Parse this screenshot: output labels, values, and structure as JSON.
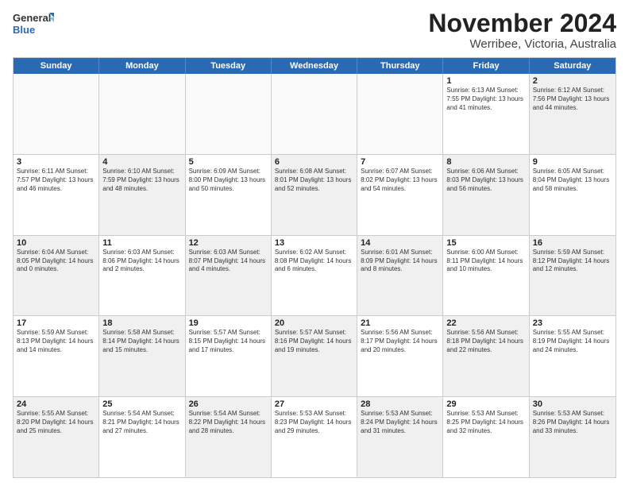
{
  "logo": {
    "general": "General",
    "blue": "Blue"
  },
  "title": "November 2024",
  "location": "Werribee, Victoria, Australia",
  "weekdays": [
    "Sunday",
    "Monday",
    "Tuesday",
    "Wednesday",
    "Thursday",
    "Friday",
    "Saturday"
  ],
  "rows": [
    [
      {
        "day": "",
        "info": "",
        "empty": true
      },
      {
        "day": "",
        "info": "",
        "empty": true
      },
      {
        "day": "",
        "info": "",
        "empty": true
      },
      {
        "day": "",
        "info": "",
        "empty": true
      },
      {
        "day": "",
        "info": "",
        "empty": true
      },
      {
        "day": "1",
        "info": "Sunrise: 6:13 AM\nSunset: 7:55 PM\nDaylight: 13 hours\nand 41 minutes."
      },
      {
        "day": "2",
        "info": "Sunrise: 6:12 AM\nSunset: 7:56 PM\nDaylight: 13 hours\nand 44 minutes.",
        "shaded": true
      }
    ],
    [
      {
        "day": "3",
        "info": "Sunrise: 6:11 AM\nSunset: 7:57 PM\nDaylight: 13 hours\nand 46 minutes."
      },
      {
        "day": "4",
        "info": "Sunrise: 6:10 AM\nSunset: 7:59 PM\nDaylight: 13 hours\nand 48 minutes.",
        "shaded": true
      },
      {
        "day": "5",
        "info": "Sunrise: 6:09 AM\nSunset: 8:00 PM\nDaylight: 13 hours\nand 50 minutes."
      },
      {
        "day": "6",
        "info": "Sunrise: 6:08 AM\nSunset: 8:01 PM\nDaylight: 13 hours\nand 52 minutes.",
        "shaded": true
      },
      {
        "day": "7",
        "info": "Sunrise: 6:07 AM\nSunset: 8:02 PM\nDaylight: 13 hours\nand 54 minutes."
      },
      {
        "day": "8",
        "info": "Sunrise: 6:06 AM\nSunset: 8:03 PM\nDaylight: 13 hours\nand 56 minutes.",
        "shaded": true
      },
      {
        "day": "9",
        "info": "Sunrise: 6:05 AM\nSunset: 8:04 PM\nDaylight: 13 hours\nand 58 minutes."
      }
    ],
    [
      {
        "day": "10",
        "info": "Sunrise: 6:04 AM\nSunset: 8:05 PM\nDaylight: 14 hours\nand 0 minutes.",
        "shaded": true
      },
      {
        "day": "11",
        "info": "Sunrise: 6:03 AM\nSunset: 8:06 PM\nDaylight: 14 hours\nand 2 minutes."
      },
      {
        "day": "12",
        "info": "Sunrise: 6:03 AM\nSunset: 8:07 PM\nDaylight: 14 hours\nand 4 minutes.",
        "shaded": true
      },
      {
        "day": "13",
        "info": "Sunrise: 6:02 AM\nSunset: 8:08 PM\nDaylight: 14 hours\nand 6 minutes."
      },
      {
        "day": "14",
        "info": "Sunrise: 6:01 AM\nSunset: 8:09 PM\nDaylight: 14 hours\nand 8 minutes.",
        "shaded": true
      },
      {
        "day": "15",
        "info": "Sunrise: 6:00 AM\nSunset: 8:11 PM\nDaylight: 14 hours\nand 10 minutes."
      },
      {
        "day": "16",
        "info": "Sunrise: 5:59 AM\nSunset: 8:12 PM\nDaylight: 14 hours\nand 12 minutes.",
        "shaded": true
      }
    ],
    [
      {
        "day": "17",
        "info": "Sunrise: 5:59 AM\nSunset: 8:13 PM\nDaylight: 14 hours\nand 14 minutes."
      },
      {
        "day": "18",
        "info": "Sunrise: 5:58 AM\nSunset: 8:14 PM\nDaylight: 14 hours\nand 15 minutes.",
        "shaded": true
      },
      {
        "day": "19",
        "info": "Sunrise: 5:57 AM\nSunset: 8:15 PM\nDaylight: 14 hours\nand 17 minutes."
      },
      {
        "day": "20",
        "info": "Sunrise: 5:57 AM\nSunset: 8:16 PM\nDaylight: 14 hours\nand 19 minutes.",
        "shaded": true
      },
      {
        "day": "21",
        "info": "Sunrise: 5:56 AM\nSunset: 8:17 PM\nDaylight: 14 hours\nand 20 minutes."
      },
      {
        "day": "22",
        "info": "Sunrise: 5:56 AM\nSunset: 8:18 PM\nDaylight: 14 hours\nand 22 minutes.",
        "shaded": true
      },
      {
        "day": "23",
        "info": "Sunrise: 5:55 AM\nSunset: 8:19 PM\nDaylight: 14 hours\nand 24 minutes."
      }
    ],
    [
      {
        "day": "24",
        "info": "Sunrise: 5:55 AM\nSunset: 8:20 PM\nDaylight: 14 hours\nand 25 minutes.",
        "shaded": true
      },
      {
        "day": "25",
        "info": "Sunrise: 5:54 AM\nSunset: 8:21 PM\nDaylight: 14 hours\nand 27 minutes."
      },
      {
        "day": "26",
        "info": "Sunrise: 5:54 AM\nSunset: 8:22 PM\nDaylight: 14 hours\nand 28 minutes.",
        "shaded": true
      },
      {
        "day": "27",
        "info": "Sunrise: 5:53 AM\nSunset: 8:23 PM\nDaylight: 14 hours\nand 29 minutes."
      },
      {
        "day": "28",
        "info": "Sunrise: 5:53 AM\nSunset: 8:24 PM\nDaylight: 14 hours\nand 31 minutes.",
        "shaded": true
      },
      {
        "day": "29",
        "info": "Sunrise: 5:53 AM\nSunset: 8:25 PM\nDaylight: 14 hours\nand 32 minutes."
      },
      {
        "day": "30",
        "info": "Sunrise: 5:53 AM\nSunset: 8:26 PM\nDaylight: 14 hours\nand 33 minutes.",
        "shaded": true
      }
    ]
  ]
}
